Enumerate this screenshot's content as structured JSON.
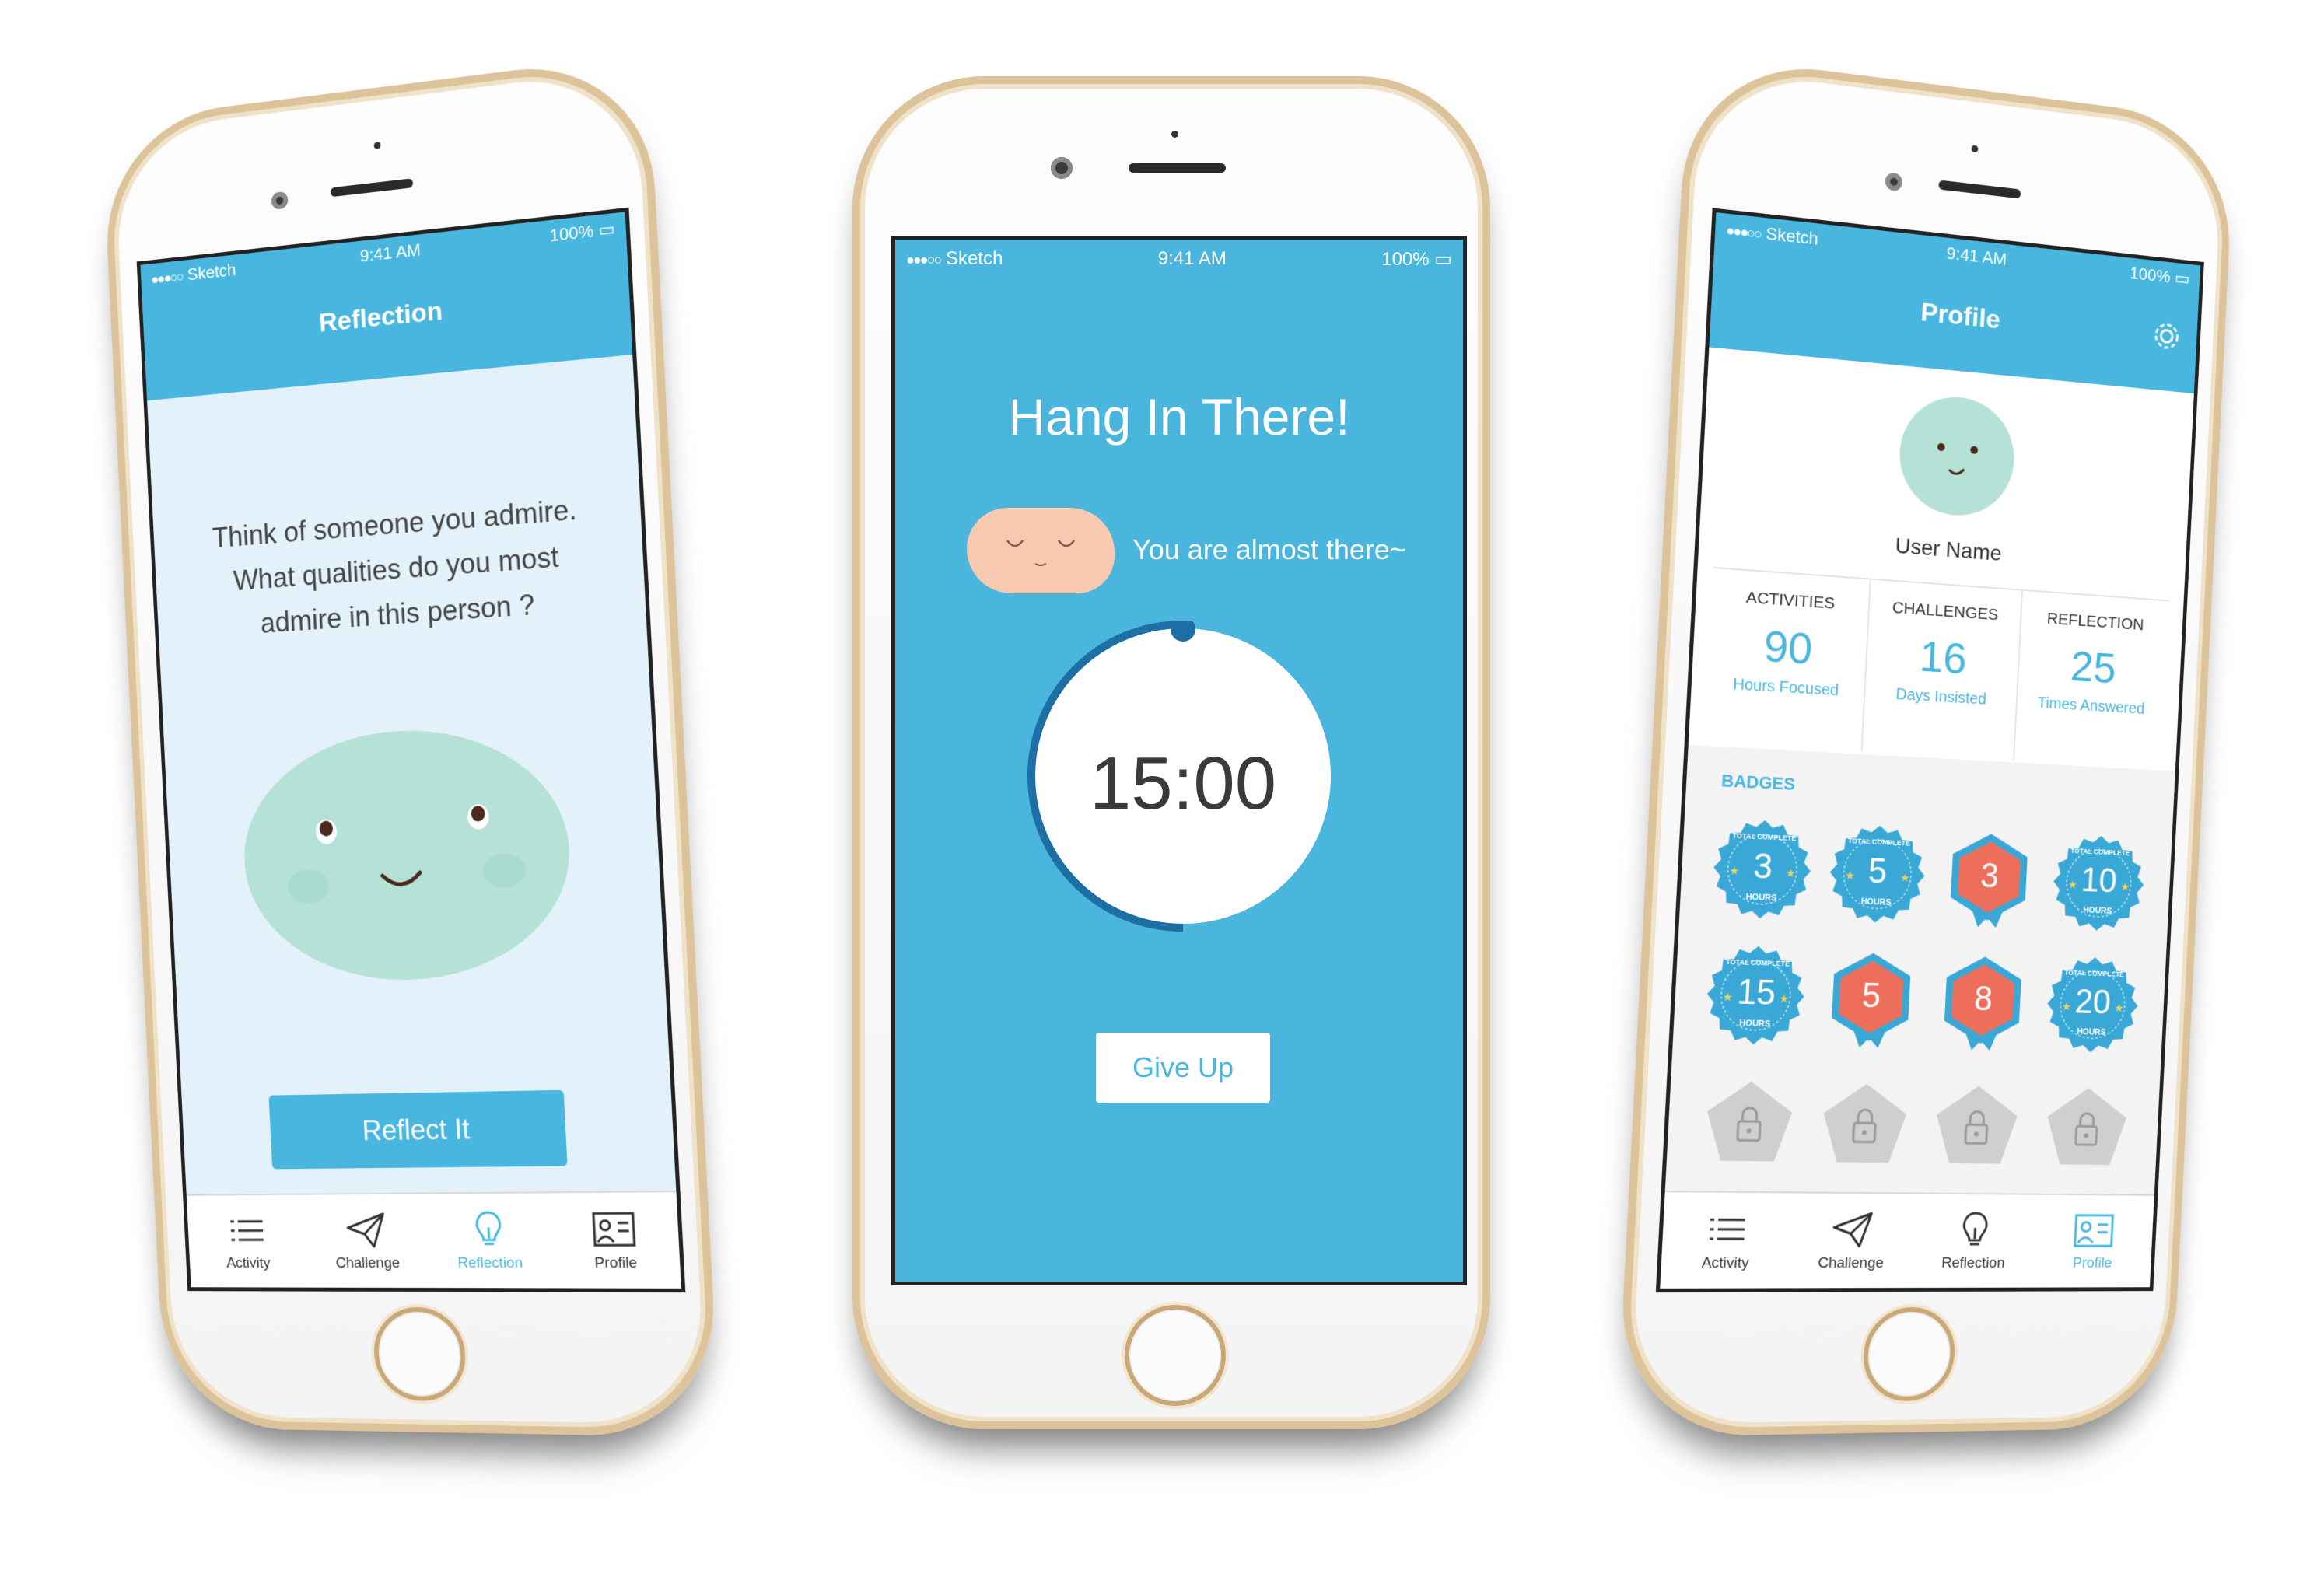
{
  "status": {
    "carrier": "Sketch",
    "time": "9:41 AM",
    "battery": "100%"
  },
  "left": {
    "title": "Reflection",
    "question": "Think of someone you admire. What qualities do you most admire in this person ?",
    "button": "Reflect It",
    "mascot_color": "#b5e1d6"
  },
  "middle": {
    "title": "Hang In There!",
    "message": "You are almost there~",
    "timer": "15:00",
    "progress": 0.5,
    "button": "Give Up",
    "background": "#4ab5dd"
  },
  "right": {
    "title": "Profile",
    "user_name": "User Name",
    "stats": [
      {
        "label": "ACTIVITIES",
        "value": "90",
        "sub": "Hours Focused"
      },
      {
        "label": "CHALLENGES",
        "value": "16",
        "sub": "Days Insisted"
      },
      {
        "label": "REFLECTION",
        "value": "25",
        "sub": "Times Answered"
      }
    ],
    "badges_title": "BADGES",
    "badges": [
      {
        "value": "3",
        "sub": "HOURS",
        "top": "TOTAL COMPLETE",
        "kind": "seal"
      },
      {
        "value": "5",
        "sub": "HOURS",
        "top": "TOTAL COMPLETE",
        "kind": "seal"
      },
      {
        "value": "3",
        "sub": "",
        "top": "",
        "kind": "hex"
      },
      {
        "value": "10",
        "sub": "HOURS",
        "top": "TOTAL COMPLETE",
        "kind": "seal"
      },
      {
        "value": "15",
        "sub": "HOURS",
        "top": "TOTAL COMPLETE",
        "kind": "seal"
      },
      {
        "value": "5",
        "sub": "",
        "top": "",
        "kind": "hex"
      },
      {
        "value": "8",
        "sub": "",
        "top": "",
        "kind": "hex"
      },
      {
        "value": "20",
        "sub": "HOURS",
        "top": "TOTAL COMPLETE",
        "kind": "seal"
      },
      {
        "kind": "locked"
      },
      {
        "kind": "locked"
      },
      {
        "kind": "locked"
      },
      {
        "kind": "locked"
      }
    ]
  },
  "tabs": [
    {
      "label": "Activity",
      "icon": "list-icon"
    },
    {
      "label": "Challenge",
      "icon": "paper-plane-icon"
    },
    {
      "label": "Reflection",
      "icon": "lightbulb-icon"
    },
    {
      "label": "Profile",
      "icon": "profile-card-icon"
    }
  ],
  "colors": {
    "accent": "#48b6de",
    "badge_blue": "#3aa8d6",
    "badge_red": "#ee6e5c",
    "locked": "#cfcfcf",
    "phone_gold": "#dcc39a"
  }
}
